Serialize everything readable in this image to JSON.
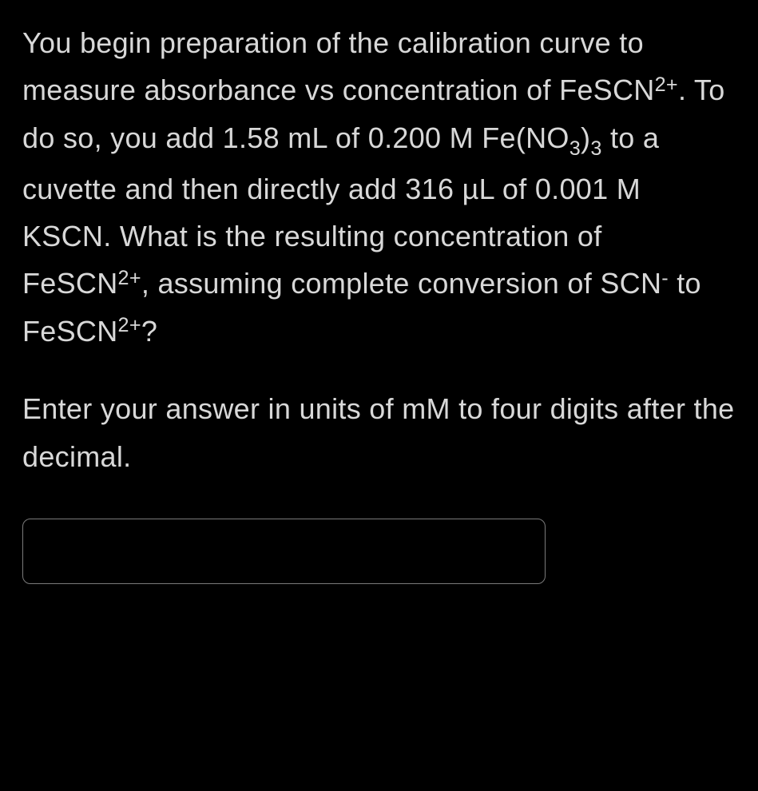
{
  "question": {
    "p1_a": "You begin preparation of the calibration curve to measure absorbance vs concentration of FeSCN",
    "p1_sup1": "2+",
    "p1_b": ". To do so, you add 1.58 mL of 0.200 M Fe(NO",
    "p1_sub1": "3",
    "p1_c": ")",
    "p1_sub2": "3",
    "p1_d": " to a cuvette and then directly add 316 µL of 0.001 M KSCN. What is the resulting concentration of FeSCN",
    "p1_sup2": "2+",
    "p1_e": ", assuming complete conversion of SCN",
    "p1_sup3": "-",
    "p1_f": " to FeSCN",
    "p1_sup4": "2+",
    "p1_g": "?",
    "p2": "Enter your answer in units of mM to four digits after the decimal."
  },
  "input": {
    "value": ""
  }
}
